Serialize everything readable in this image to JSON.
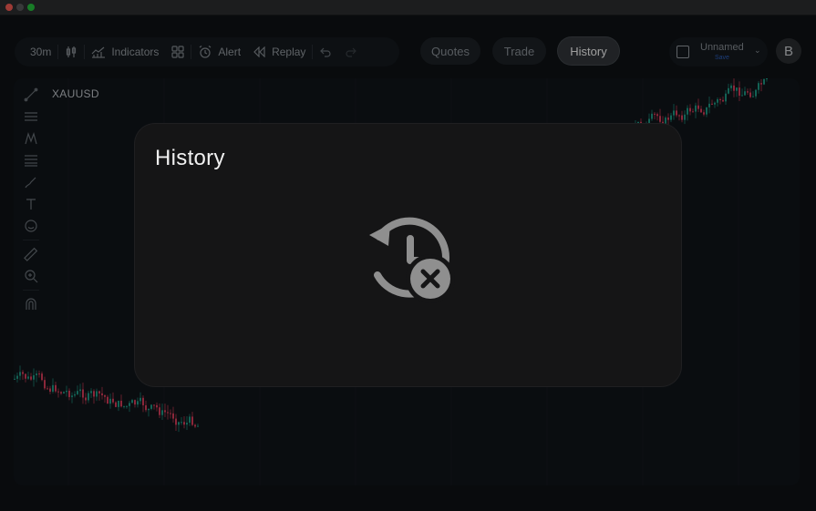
{
  "window": {
    "controls": [
      "close",
      "minimize",
      "zoom"
    ]
  },
  "toolbar": {
    "interval": "30m",
    "indicators_label": "Indicators",
    "alert_label": "Alert",
    "replay_label": "Replay",
    "icons": [
      "candles-icon",
      "indicators-icon",
      "templates-icon",
      "alert-icon",
      "replay-icon",
      "undo-icon",
      "redo-icon"
    ]
  },
  "tabs": [
    {
      "label": "Quotes",
      "active": false
    },
    {
      "label": "Trade",
      "active": false
    },
    {
      "label": "History",
      "active": true
    }
  ],
  "layout": {
    "name": "Unnamed",
    "save_label": "Save"
  },
  "user": {
    "avatar_initial": "B"
  },
  "chart": {
    "symbol": "XAUUSD"
  },
  "drawing_tools": [
    "trend-line",
    "horizontal-lines",
    "pattern",
    "fib",
    "brush",
    "text",
    "emoji",
    "ruler",
    "zoom-in",
    "magnet"
  ],
  "dialog": {
    "title": "History",
    "empty_state_icon": "history-off-icon"
  },
  "colors": {
    "up": "#1f9e89",
    "down": "#e0405e",
    "active_tab": "#34383c",
    "save": "#2e62c4"
  }
}
